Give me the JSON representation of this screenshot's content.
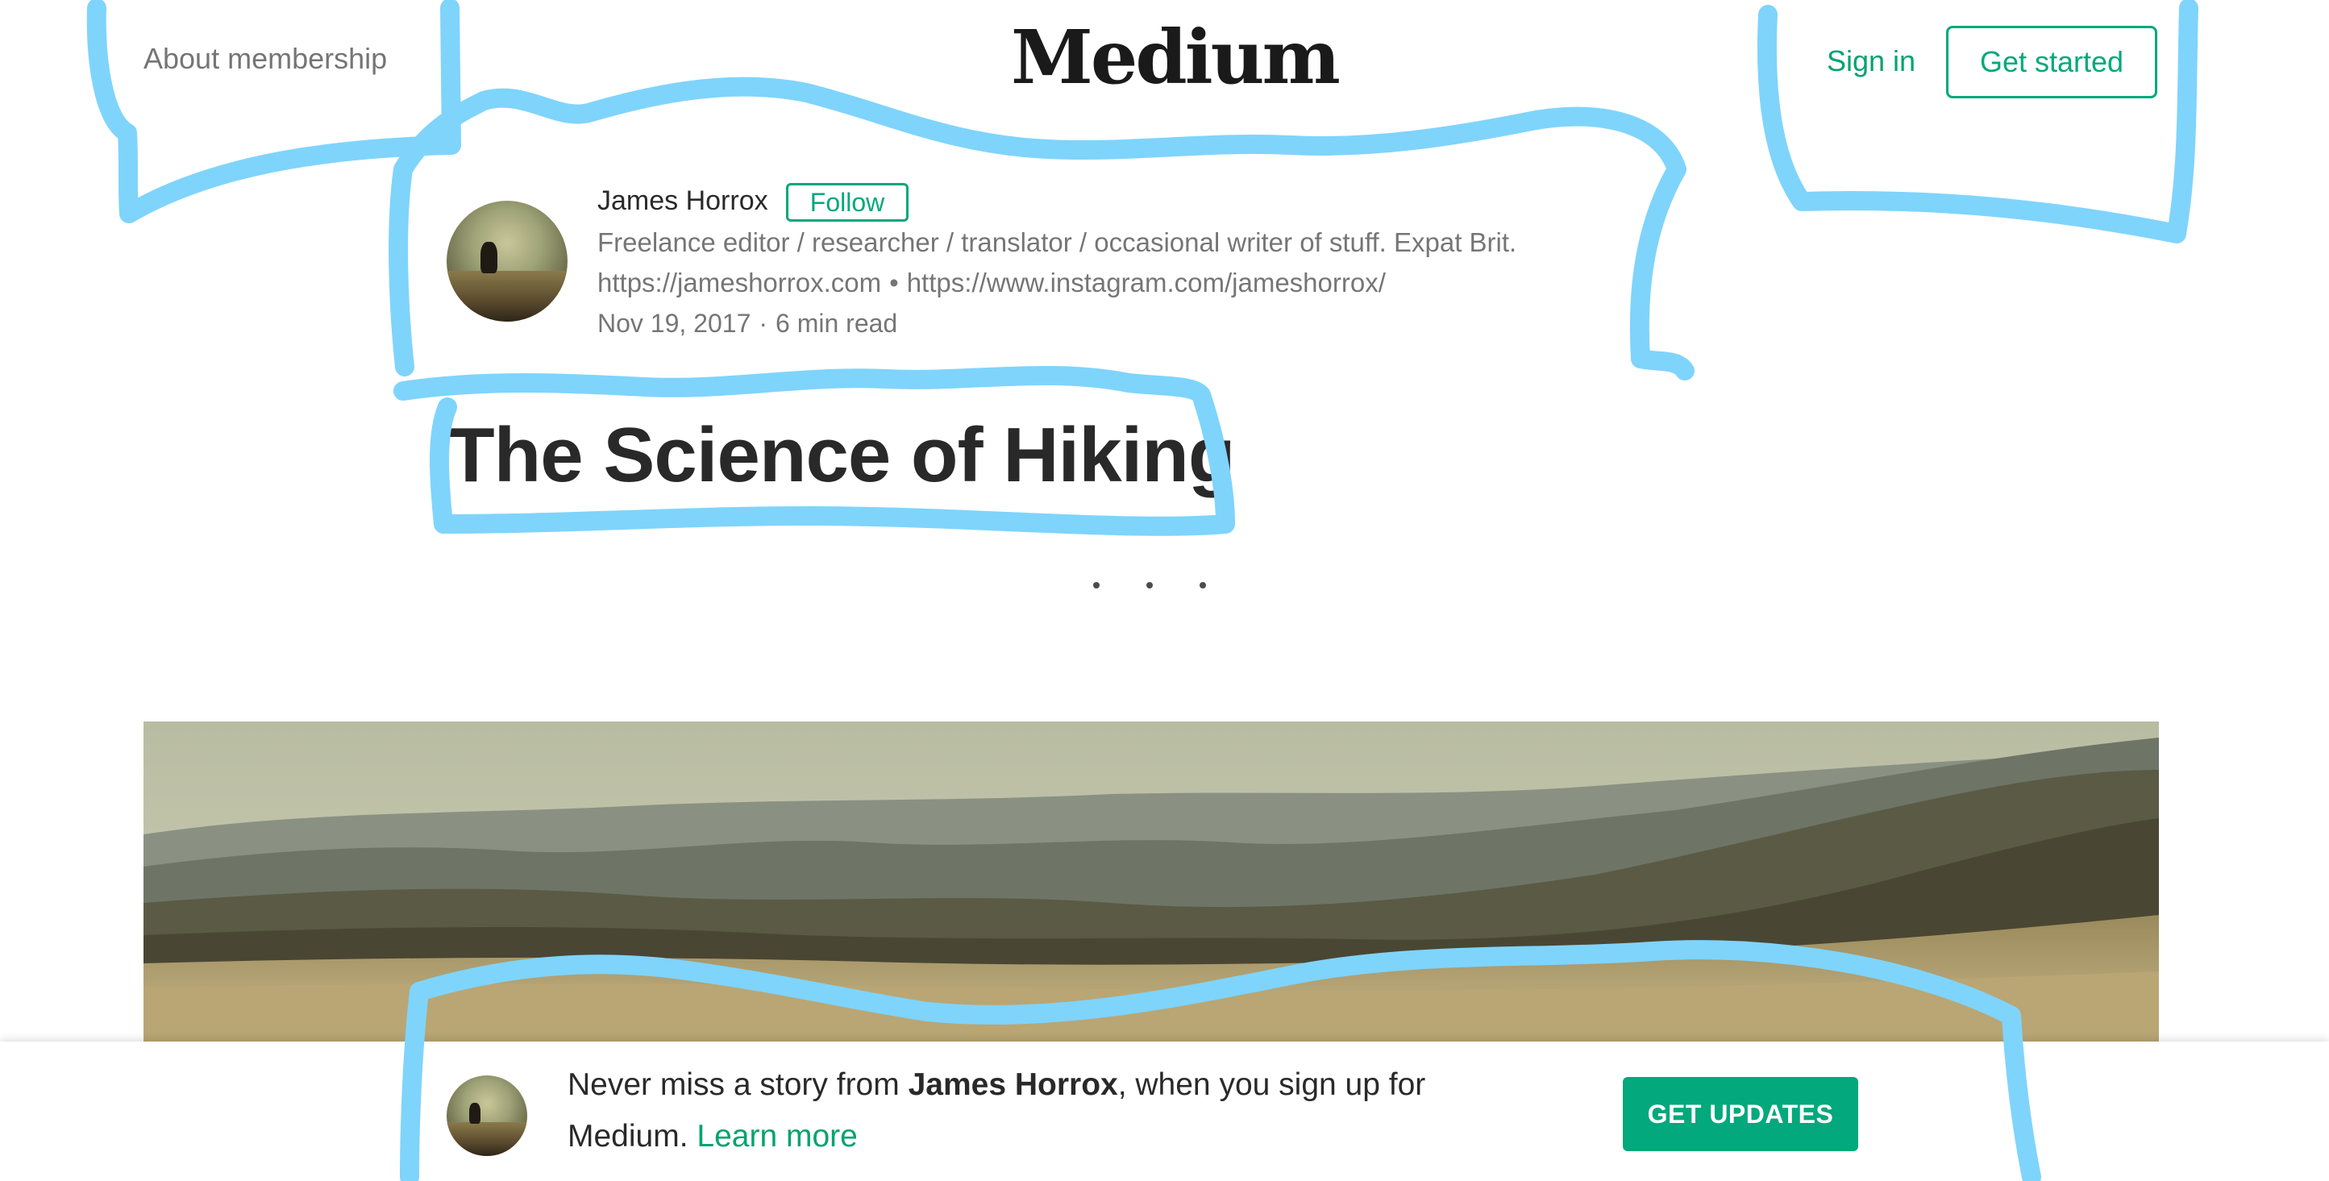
{
  "nav": {
    "about_label": "About membership",
    "logo_text": "Medium",
    "signin_label": "Sign in",
    "getstarted_label": "Get started"
  },
  "author": {
    "name": "James Horrox",
    "follow_label": "Follow",
    "bio": "Freelance editor / researcher / translator / occasional writer of stuff. Expat Brit.",
    "website": "https://jameshorrox.com",
    "link_separator": "•",
    "instagram": "https://www.instagram.com/jameshorrox/",
    "date": "Nov 19, 2017",
    "meta_separator": "·",
    "read_time": "6 min read"
  },
  "article": {
    "title": "The Science of Hiking"
  },
  "banner": {
    "prefix": "Never miss a story from ",
    "author_name": "James Horrox",
    "suffix": ", when you sign up for Medium. ",
    "learn_more_label": "Learn more",
    "cta_label": "GET UPDATES"
  },
  "colors": {
    "accent_green": "#03a87c",
    "annotation_blue": "#7fd4fc"
  }
}
